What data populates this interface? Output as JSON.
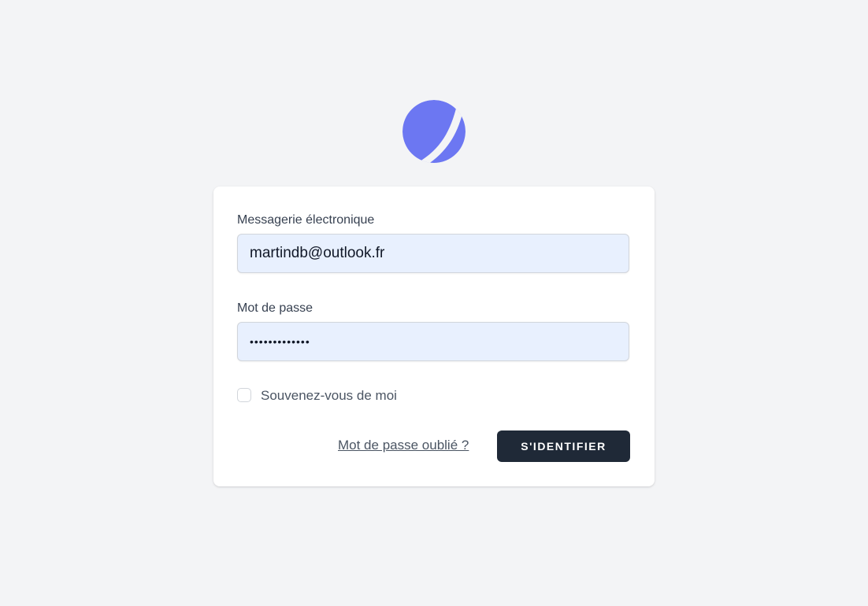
{
  "logo": {
    "icon": "app-logo-icon",
    "color": "#6c77f2"
  },
  "form": {
    "email_label": "Messagerie électronique",
    "email_value": "martindb@outlook.fr",
    "password_label": "Mot de passe",
    "password_value": "•••••••••••••",
    "remember_label": "Souvenez-vous de moi",
    "remember_checked": false,
    "forgot_link": "Mot de passe oublié ?",
    "submit_label": "S'IDENTIFIER"
  },
  "colors": {
    "background": "#f3f4f6",
    "card": "#ffffff",
    "input_fill": "#e8f0fe",
    "button": "#1f2937",
    "accent": "#6c77f2"
  }
}
